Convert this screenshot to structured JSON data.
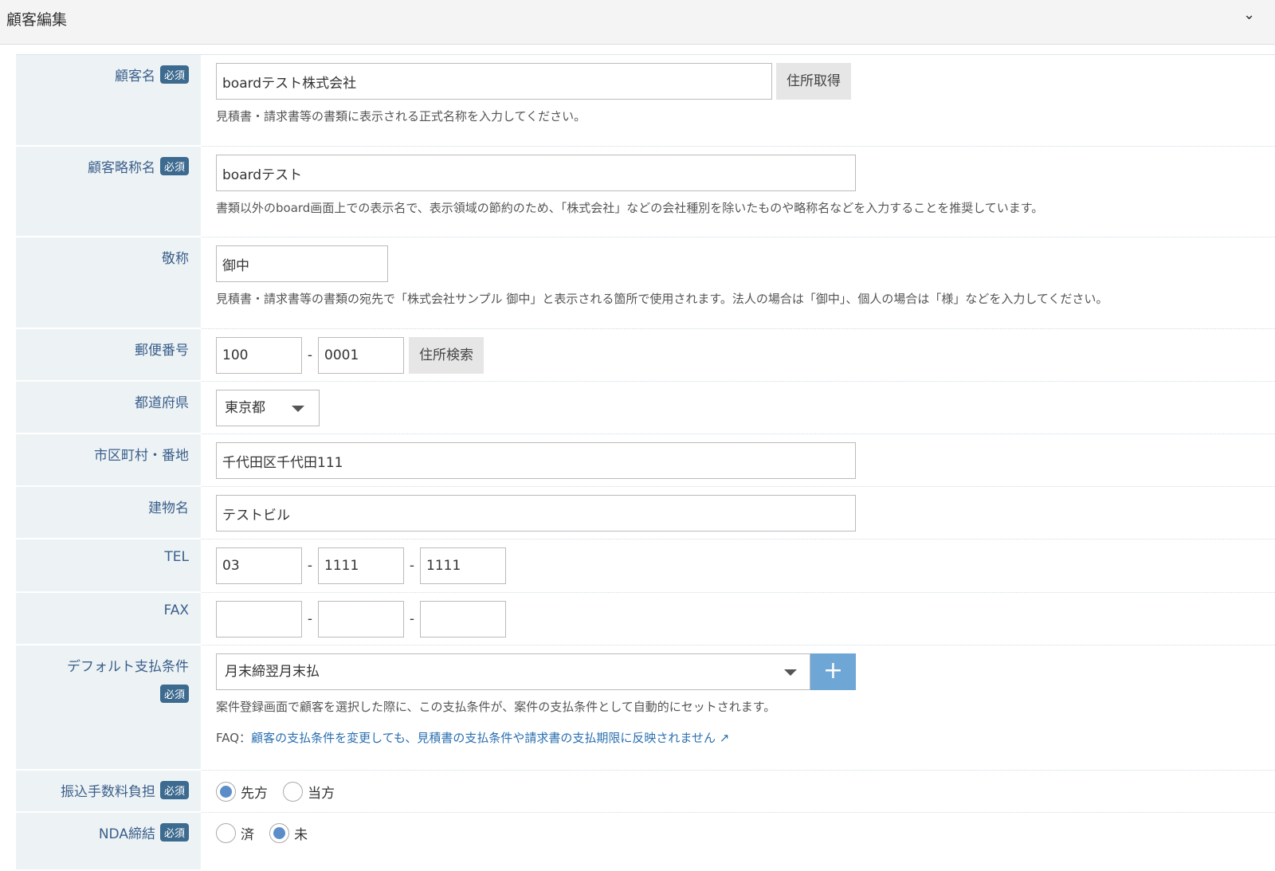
{
  "header": {
    "title": "顧客編集"
  },
  "required": "必須",
  "fields": {
    "name": {
      "label": "顧客名",
      "value": "boardテスト株式会社",
      "button": "住所取得",
      "help": "見積書・請求書等の書類に表示される正式名称を入力してください。"
    },
    "short": {
      "label": "顧客略称名",
      "value": "boardテスト",
      "help": "書類以外のboard画面上での表示名で、表示領域の節約のため、「株式会社」などの会社種別を除いたものや略称名などを入力することを推奨しています。"
    },
    "honorific": {
      "label": "敬称",
      "value": "御中",
      "help": "見積書・請求書等の書類の宛先で「株式会社サンプル 御中」と表示される箇所で使用されます。法人の場合は「御中」、個人の場合は「様」などを入力してください。"
    },
    "zip": {
      "label": "郵便番号",
      "v1": "100",
      "v2": "0001",
      "sep": "-",
      "button": "住所検索"
    },
    "pref": {
      "label": "都道府県",
      "value": "東京都"
    },
    "city": {
      "label": "市区町村・番地",
      "value": "千代田区千代田111"
    },
    "building": {
      "label": "建物名",
      "value": "テストビル"
    },
    "tel": {
      "label": "TEL",
      "v1": "03",
      "v2": "1111",
      "v3": "1111"
    },
    "fax": {
      "label": "FAX",
      "v1": "",
      "v2": "",
      "v3": ""
    },
    "payment": {
      "label": "デフォルト支払条件",
      "value": "月末締翌月末払",
      "add": "+",
      "help": "案件登録画面で顧客を選択した際に、この支払条件が、案件の支払条件として自動的にセットされます。",
      "faq_prefix": "FAQ：",
      "faq_link": "顧客の支払条件を変更しても、見積書の支払条件や請求書の支払期限に反映されません"
    },
    "fee": {
      "label": "振込手数料負担",
      "options": [
        "先方",
        "当方"
      ],
      "selected": "先方"
    },
    "nda": {
      "label": "NDA締結",
      "options": [
        "済",
        "未"
      ],
      "selected": "未"
    }
  }
}
